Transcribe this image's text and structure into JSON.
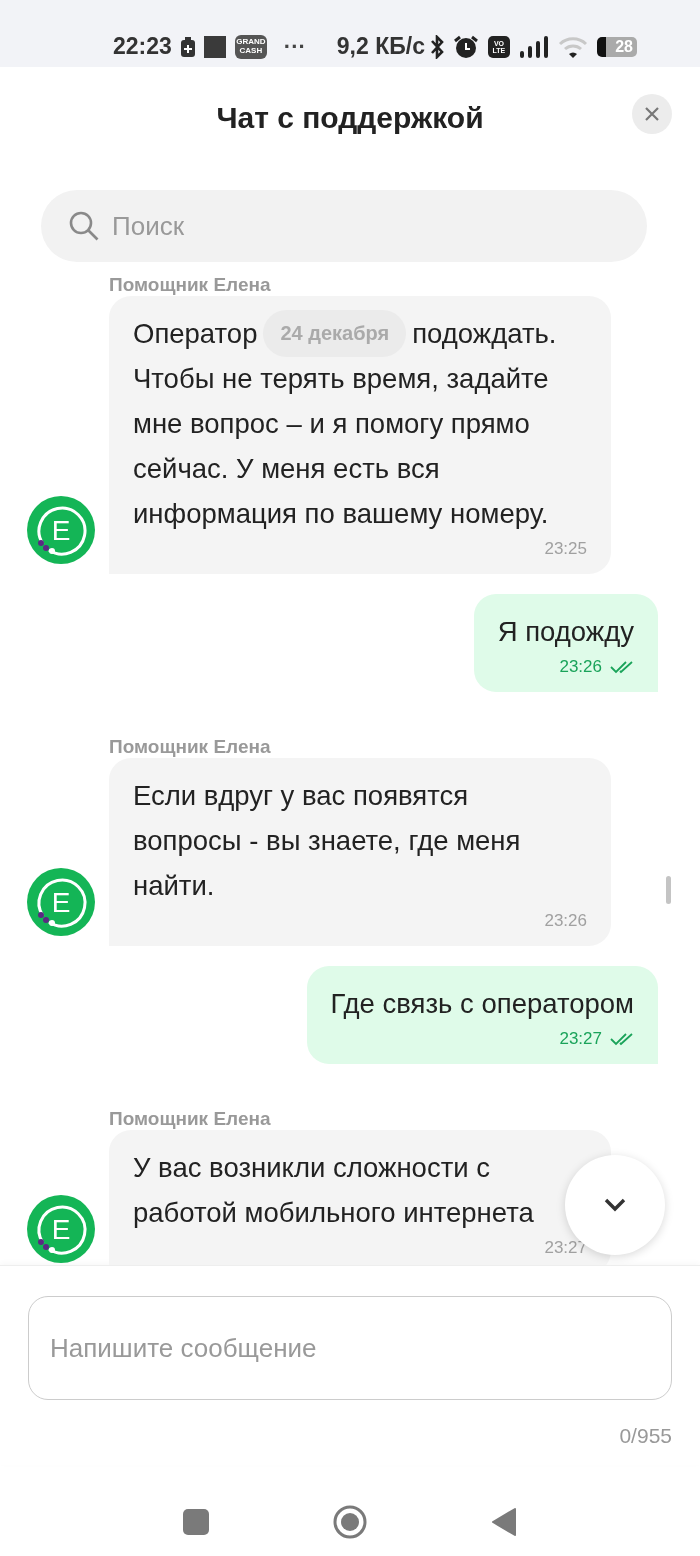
{
  "status_bar": {
    "time": "22:23",
    "app_badge": [
      "GRAND",
      "CASH"
    ],
    "more": "···",
    "speed": "9,2 КБ/с",
    "volte": [
      "VO",
      "LTE"
    ],
    "battery": "28"
  },
  "header": {
    "title": "Чат с поддержкой"
  },
  "search": {
    "placeholder": "Поиск"
  },
  "messages": [
    {
      "kind": "bot",
      "sender": "Помощник Елена",
      "avatar": "E",
      "first_line": {
        "before": "Оператор",
        "date": "24 декабря",
        "after": "подождать."
      },
      "lines": [
        "Чтобы не терять время, задайте",
        "мне вопрос – и я помогу прямо",
        "сейчас. У меня есть вся",
        "информация по вашему номеру."
      ],
      "time": "23:25"
    },
    {
      "kind": "user",
      "lines": [
        "Я подожду"
      ],
      "time": "23:26",
      "read": true
    },
    {
      "kind": "bot",
      "sender": "Помощник Елена",
      "avatar": "E",
      "lines": [
        "Если вдруг у вас появятся",
        "вопросы - вы знаете, где меня",
        "найти."
      ],
      "time": "23:26"
    },
    {
      "kind": "user",
      "lines": [
        "Где связь с оператором"
      ],
      "time": "23:27",
      "read": true
    },
    {
      "kind": "bot",
      "sender": "Помощник Елена",
      "avatar": "E",
      "lines": [
        "У вас возникли сложности с",
        "работой мобильного интернета"
      ],
      "time": "23:27"
    }
  ],
  "composer": {
    "placeholder": "Напишите сообщение",
    "counter": "0/955"
  }
}
